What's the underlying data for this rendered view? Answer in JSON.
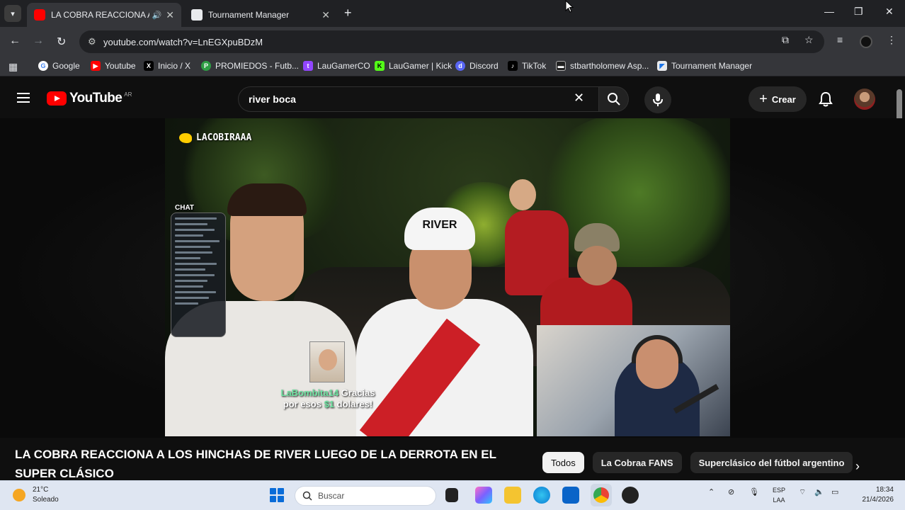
{
  "browser": {
    "tabs": [
      {
        "title": "LA COBRA REACCIONA A L",
        "active": true
      },
      {
        "title": "Tournament Manager",
        "active": false
      }
    ],
    "url": "youtube.com/watch?v=LnEGXpuBDzM",
    "bookmarks": [
      {
        "label": "Google",
        "icon": "google-icon"
      },
      {
        "label": "Youtube",
        "icon": "youtube-icon"
      },
      {
        "label": "Inicio / X",
        "icon": "x-icon"
      },
      {
        "label": "PROMIEDOS - Futb...",
        "icon": "promiedos-icon"
      },
      {
        "label": "LauGamerCO",
        "icon": "twitch-icon"
      },
      {
        "label": "LauGamer | Kick",
        "icon": "kick-icon"
      },
      {
        "label": "Discord",
        "icon": "discord-icon"
      },
      {
        "label": "TikTok",
        "icon": "tiktok-icon"
      },
      {
        "label": "stbartholomew Asp...",
        "icon": "bookmark-icon"
      },
      {
        "label": "Tournament Manager",
        "icon": "tournament-icon"
      }
    ]
  },
  "youtube": {
    "logo_text": "YouTube",
    "region": "AR",
    "search_query": "river boca",
    "create_label": "Crear"
  },
  "video": {
    "overlay_handle": "LACOBIRAAA",
    "chat_label": "CHAT",
    "donation": {
      "nick": "LaBombita14",
      "message_part1": "Gracias",
      "message_part2": "por esos",
      "amount": "$1",
      "message_part3": "dolares!"
    },
    "shirt_text": "RIVER",
    "title": "LA COBRA REACCIONA A LOS HINCHAS DE RIVER LUEGO DE LA DERROTA EN EL SUPER CLÁSICO"
  },
  "chips": [
    {
      "label": "Todos",
      "active": true
    },
    {
      "label": "La Cobraa FANS",
      "active": false
    },
    {
      "label": "Superclásico del fútbol argentino",
      "active": false
    }
  ],
  "taskbar": {
    "weather_temp": "21°C",
    "weather_desc": "Soleado",
    "search_placeholder": "Buscar",
    "lang_top": "ESP",
    "lang_bottom": "LAA",
    "time": "18:34",
    "date": "21/4/2026"
  },
  "colors": {
    "yt_red": "#ff0000",
    "chip_active_bg": "#f1f1f1",
    "donation_green": "#6fe3a2"
  }
}
